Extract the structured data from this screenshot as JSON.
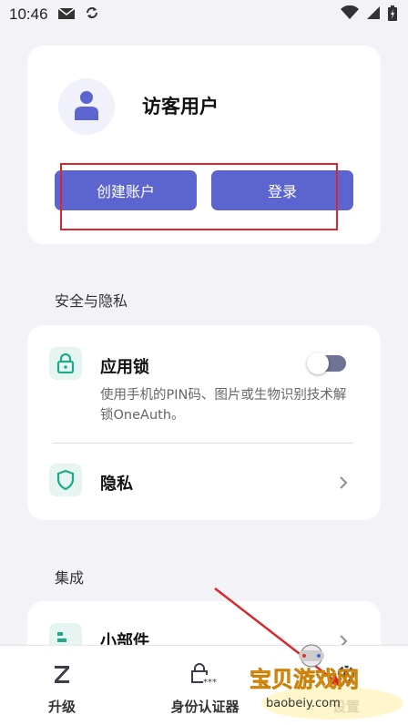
{
  "status_bar": {
    "time": "10:46",
    "icons": [
      "mail-icon",
      "sync-icon",
      "wifi-icon",
      "signal-icon",
      "battery-icon"
    ]
  },
  "profile": {
    "name": "访客用户",
    "create_account_label": "创建账户",
    "login_label": "登录"
  },
  "sections": {
    "security_title": "安全与隐私",
    "integration_title": "集成"
  },
  "security": {
    "app_lock": {
      "title": "应用锁",
      "description": "使用手机的PIN码、图片或生物识别技术解锁OneAuth。",
      "enabled": false
    },
    "privacy": {
      "title": "隐私"
    }
  },
  "integration": {
    "widgets": {
      "title": "小部件"
    }
  },
  "bottom_nav": {
    "upgrade": "升级",
    "authenticator": "身份认证器",
    "settings": "设置"
  },
  "watermark": {
    "brand": "宝贝游戏网",
    "url": "baobeiy.com"
  },
  "colors": {
    "accent": "#5b64cf",
    "icon_tint": "#1fa98b",
    "icon_bg": "#e6f5f1",
    "annotation": "#d8282e"
  }
}
